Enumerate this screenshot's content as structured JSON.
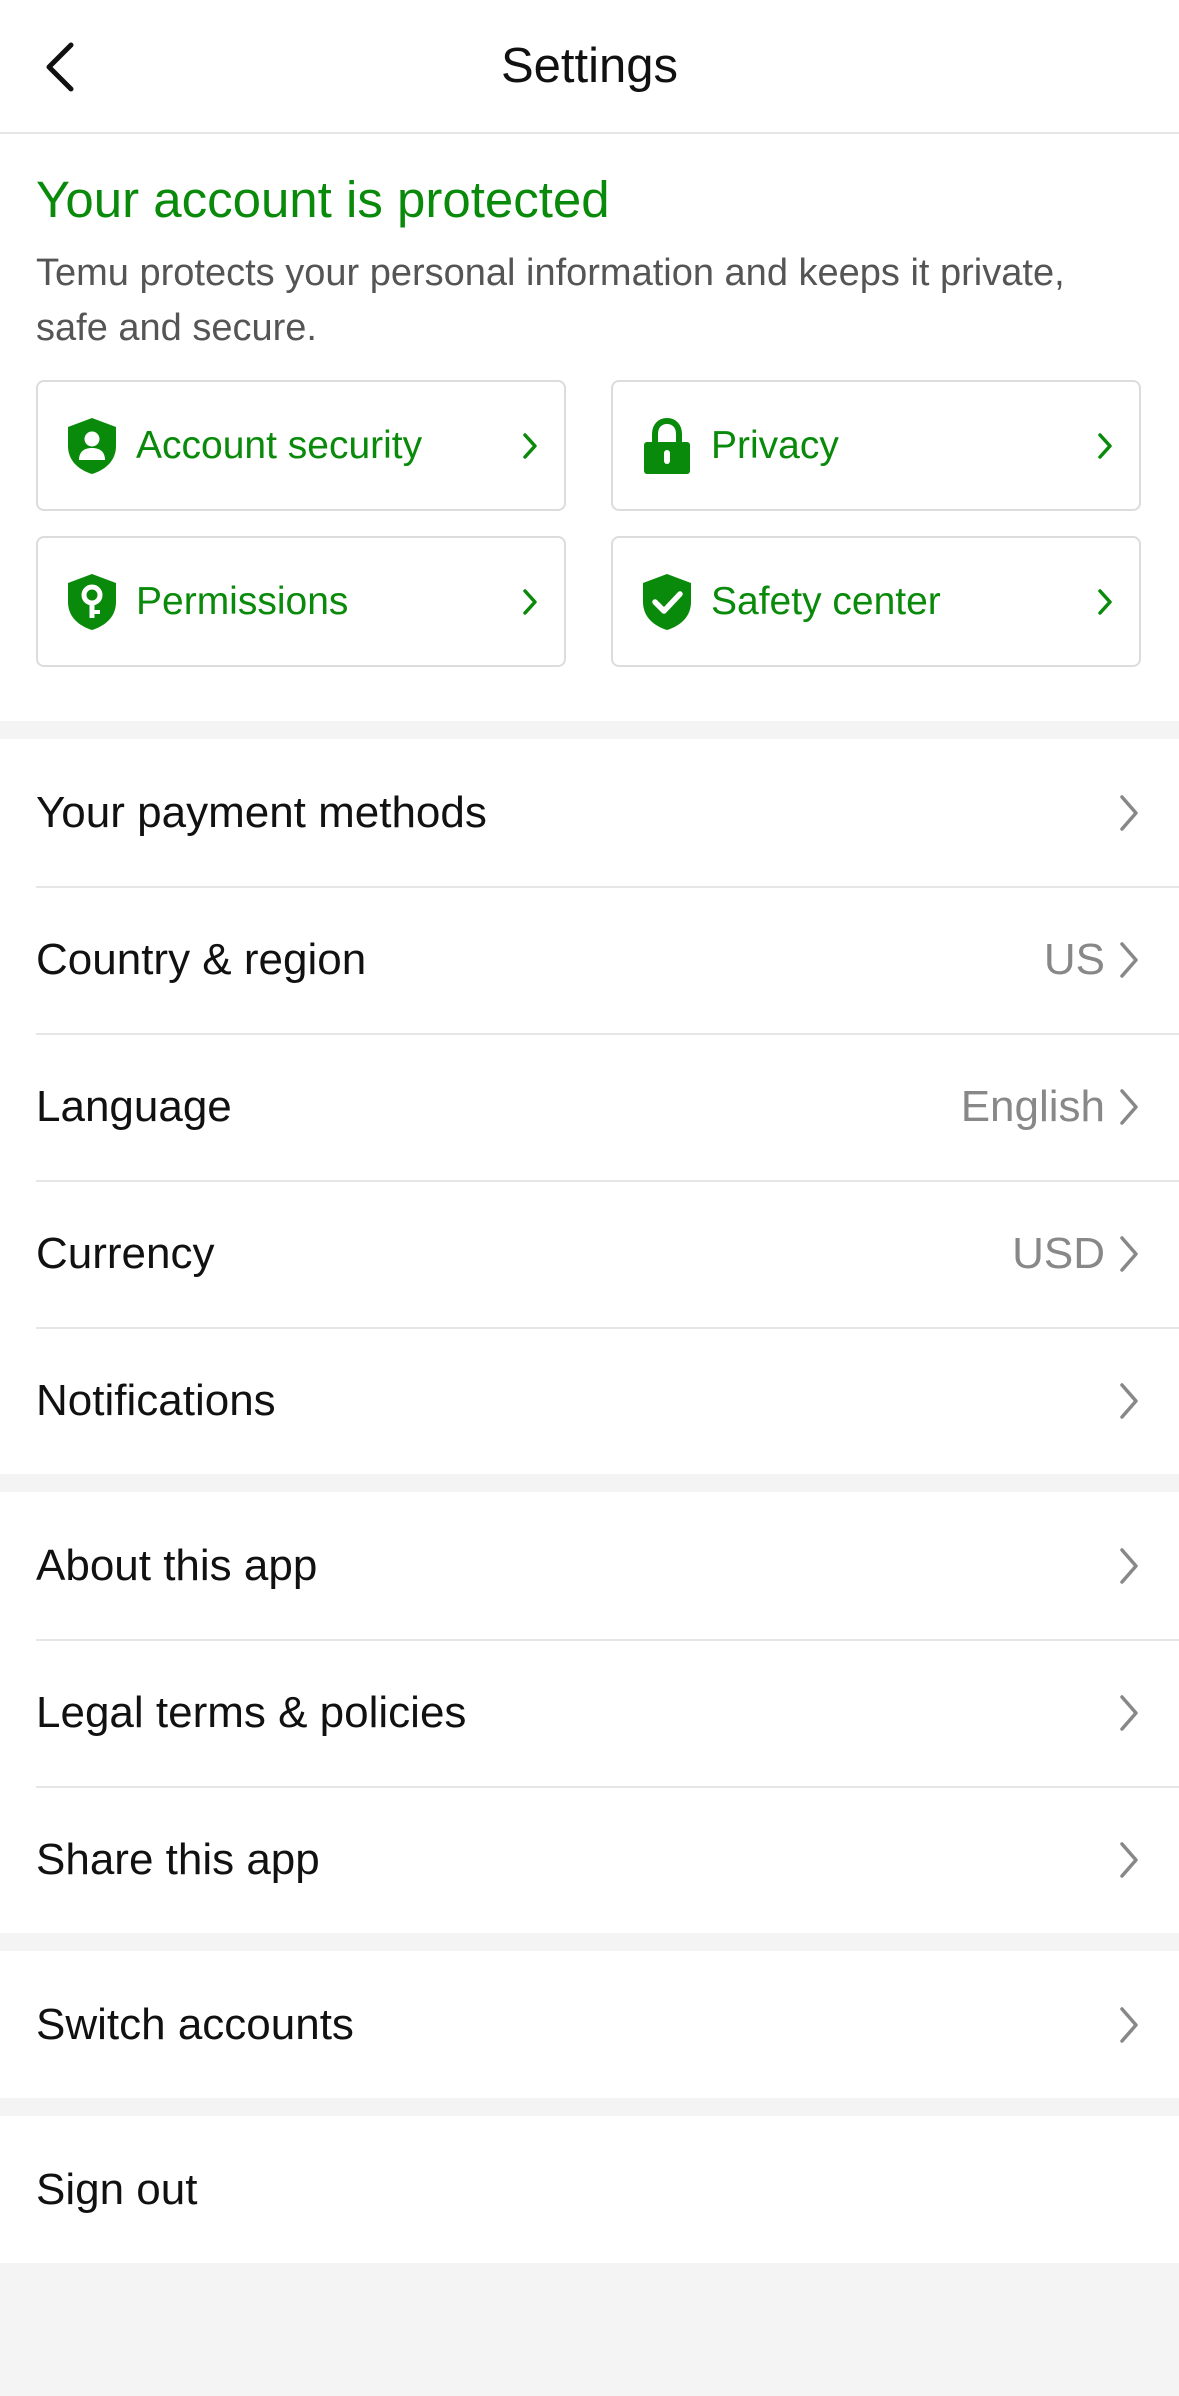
{
  "header": {
    "title": "Settings"
  },
  "protection": {
    "title": "Your account is protected",
    "description": "Temu protects your personal information and keeps it private, safe and secure.",
    "accent_color": "#0a8a0a",
    "cards": [
      {
        "label": "Account security",
        "icon": "shield-person-icon"
      },
      {
        "label": "Privacy",
        "icon": "lock-icon"
      },
      {
        "label": "Permissions",
        "icon": "shield-key-icon"
      },
      {
        "label": "Safety center",
        "icon": "shield-check-icon"
      }
    ]
  },
  "preferences": {
    "items": [
      {
        "label": "Your payment methods",
        "value": ""
      },
      {
        "label": "Country & region",
        "value": "US"
      },
      {
        "label": "Language",
        "value": "English"
      },
      {
        "label": "Currency",
        "value": "USD"
      },
      {
        "label": "Notifications",
        "value": ""
      }
    ]
  },
  "about": {
    "items": [
      {
        "label": "About this app"
      },
      {
        "label": "Legal terms & policies"
      },
      {
        "label": "Share this app"
      }
    ]
  },
  "accounts": {
    "switch_label": "Switch accounts"
  },
  "signout": {
    "label": "Sign out"
  }
}
